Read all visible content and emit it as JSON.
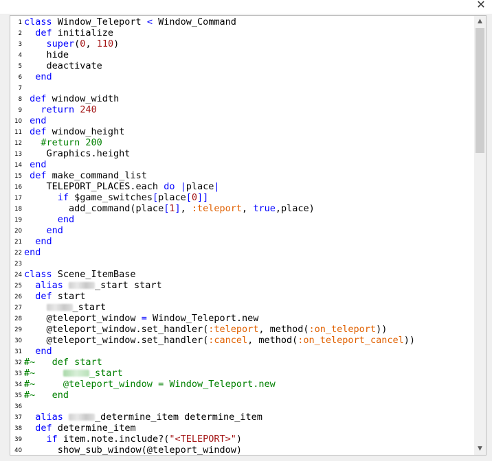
{
  "window": {
    "close_label": "✕"
  },
  "scrollbar": {
    "up_label": "▲",
    "down_label": "▼",
    "scroll_position": 0.0
  },
  "code_lines": [
    {
      "n": "1",
      "html": "<span class=\"kw\">class</span> Window_Teleport <span class=\"kw\">&lt;</span> Window_Command"
    },
    {
      "n": "2",
      "html": "  <span class=\"kw\">def</span> initialize"
    },
    {
      "n": "3",
      "html": "    <span class=\"call\">super</span>(<span class=\"num\">0</span>, <span class=\"num\">110</span>)"
    },
    {
      "n": "4",
      "html": "    hide"
    },
    {
      "n": "5",
      "html": "    deactivate"
    },
    {
      "n": "6",
      "html": "  <span class=\"kw\">end</span>"
    },
    {
      "n": "7",
      "html": ""
    },
    {
      "n": "8",
      "html": " <span class=\"kw\">def</span> window_width"
    },
    {
      "n": "9",
      "html": "   <span class=\"kw\">return</span> <span class=\"num\">240</span>"
    },
    {
      "n": "10",
      "html": " <span class=\"kw\">end</span>"
    },
    {
      "n": "11",
      "html": " <span class=\"kw\">def</span> window_height"
    },
    {
      "n": "12",
      "html": "   <span class=\"cm\">#return 200</span>"
    },
    {
      "n": "13",
      "html": "    Graphics.height"
    },
    {
      "n": "14",
      "html": " <span class=\"kw\">end</span>"
    },
    {
      "n": "15",
      "html": " <span class=\"kw\">def</span> make_command_list"
    },
    {
      "n": "16",
      "html": "    TELEPORT_PLACES.each <span class=\"kw\">do</span> <span class=\"kw\">|</span>place<span class=\"kw\">|</span>"
    },
    {
      "n": "17",
      "html": "      <span class=\"kw\">if</span> $game_switches<span class=\"kw\">[</span>place<span class=\"kw\">[</span><span class=\"num\">0</span><span class=\"kw\">]]</span>"
    },
    {
      "n": "18",
      "html": "        add_command(place<span class=\"kw\">[</span><span class=\"num\">1</span><span class=\"kw\">]</span>, <span class=\"sym\">:teleport</span>, <span class=\"kw\">true</span>,place)"
    },
    {
      "n": "19",
      "html": "      <span class=\"kw\">end</span>"
    },
    {
      "n": "20",
      "html": "    <span class=\"kw\">end</span>"
    },
    {
      "n": "21",
      "html": "  <span class=\"kw\">end</span>"
    },
    {
      "n": "22",
      "html": "<span class=\"kw\">end</span>"
    },
    {
      "n": "23",
      "html": ""
    },
    {
      "n": "24",
      "html": "<span class=\"kw\">class</span> Scene_ItemBase"
    },
    {
      "n": "25",
      "html": "  <span class=\"kw\">alias</span> <span class=\"blur\"></span>_start start"
    },
    {
      "n": "26",
      "html": "  <span class=\"kw\">def</span> start"
    },
    {
      "n": "27",
      "html": "    <span class=\"blur\"></span>_start"
    },
    {
      "n": "28",
      "html": "    @teleport_window <span class=\"kw\">=</span> Window_Teleport.new"
    },
    {
      "n": "29",
      "html": "    @teleport_window.set_handler(<span class=\"sym\">:teleport</span>, method(<span class=\"sym\">:on_teleport</span>))"
    },
    {
      "n": "30",
      "html": "    @teleport_window.set_handler(<span class=\"sym\">:cancel</span>, method(<span class=\"sym\">:on_teleport_cancel</span>))"
    },
    {
      "n": "31",
      "html": "  <span class=\"kw\">end</span>"
    },
    {
      "n": "32",
      "html": "<span class=\"cm\">#~   def start</span>"
    },
    {
      "n": "33",
      "html": "<span class=\"cm\">#~     <span class=\"blur g\"></span>_start</span>"
    },
    {
      "n": "34",
      "html": "<span class=\"cm\">#~     @teleport_window = Window_Teleport.new</span>"
    },
    {
      "n": "35",
      "html": "<span class=\"cm\">#~   end</span>"
    },
    {
      "n": "36",
      "html": ""
    },
    {
      "n": "37",
      "html": "  <span class=\"kw\">alias</span> <span class=\"blur\"></span>_determine_item determine_item"
    },
    {
      "n": "38",
      "html": "  <span class=\"kw\">def</span> determine_item"
    },
    {
      "n": "39",
      "html": "    <span class=\"kw\">if</span> item.note.include?(<span class=\"str\">\"&lt;TELEPORT&gt;\"</span>)"
    },
    {
      "n": "40",
      "html": "      show_sub_window(@teleport_window)"
    }
  ]
}
